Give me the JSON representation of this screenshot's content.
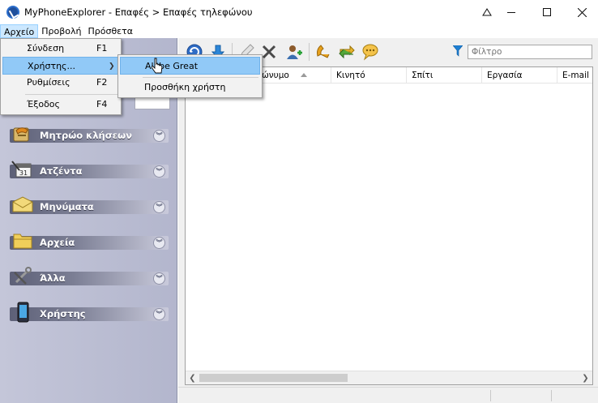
{
  "window": {
    "title": "MyPhoneExplorer -  Επαφές > Επαφές τηλεφώνου"
  },
  "menubar": {
    "items": [
      "Αρχείο",
      "Προβολή",
      "Πρόσθετα"
    ]
  },
  "file_menu": {
    "items": [
      {
        "label": "Σύνδεση",
        "shortcut": "F1"
      },
      {
        "label": "Χρήστης...",
        "shortcut": ""
      },
      {
        "label": "Ρυθμίσεις",
        "shortcut": "F2"
      },
      {
        "label": "Έξοδος",
        "shortcut": "F4"
      }
    ]
  },
  "user_submenu": {
    "items": [
      {
        "label": "All be Great"
      },
      {
        "label": "Προσθήκη χρήστη"
      }
    ]
  },
  "sidebar": {
    "items": [
      {
        "label": "Μητρώο κλήσεων",
        "icon": "phone-log-icon"
      },
      {
        "label": "Ατζέντα",
        "icon": "calendar-icon"
      },
      {
        "label": "Μηνύματα",
        "icon": "envelope-icon"
      },
      {
        "label": "Αρχεία",
        "icon": "folder-icon"
      },
      {
        "label": "Άλλα",
        "icon": "tools-icon"
      },
      {
        "label": "Χρήστης",
        "icon": "phone-icon"
      }
    ]
  },
  "toolbar": {
    "filter_placeholder": "Φίλτρο"
  },
  "grid": {
    "columns": [
      "ώνυμο",
      "Κινητό",
      "Σπίτι",
      "Εργασία",
      "E-mail"
    ]
  },
  "colors": {
    "menu_highlight": "#91c9f7",
    "sidebar_bg": "#c4c6d9"
  }
}
